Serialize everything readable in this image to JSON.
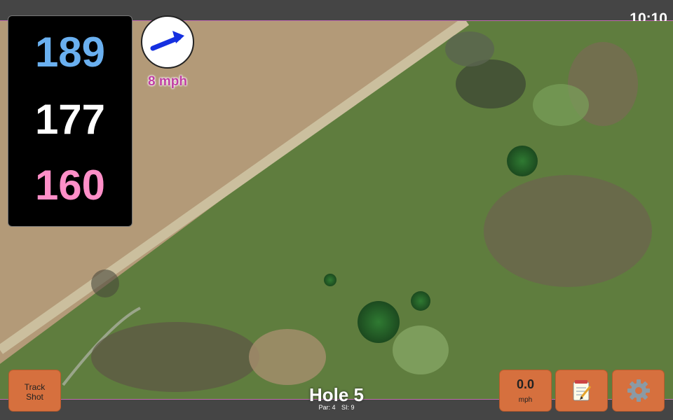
{
  "status": {
    "clock": "10:10"
  },
  "distances": {
    "back": "189",
    "middle": "177",
    "front": "160"
  },
  "wind": {
    "speed": "8 mph",
    "direction_icon": "arrow-up-right-icon"
  },
  "hole": {
    "title": "Hole 5",
    "par": "Par: 4",
    "stroke_index": "SI: 9"
  },
  "buttons": {
    "track_shot": "Track\nShot",
    "speed_value": "0.0",
    "speed_unit": "mph",
    "notes_icon": "notepad-icon",
    "settings_icon": "gear-icon"
  },
  "colors": {
    "back_distance": "#6ab0f0",
    "middle_distance": "#ffffff",
    "front_distance": "#ff8fc8",
    "wind_text": "#c03fa3",
    "button": "#d6703e"
  }
}
